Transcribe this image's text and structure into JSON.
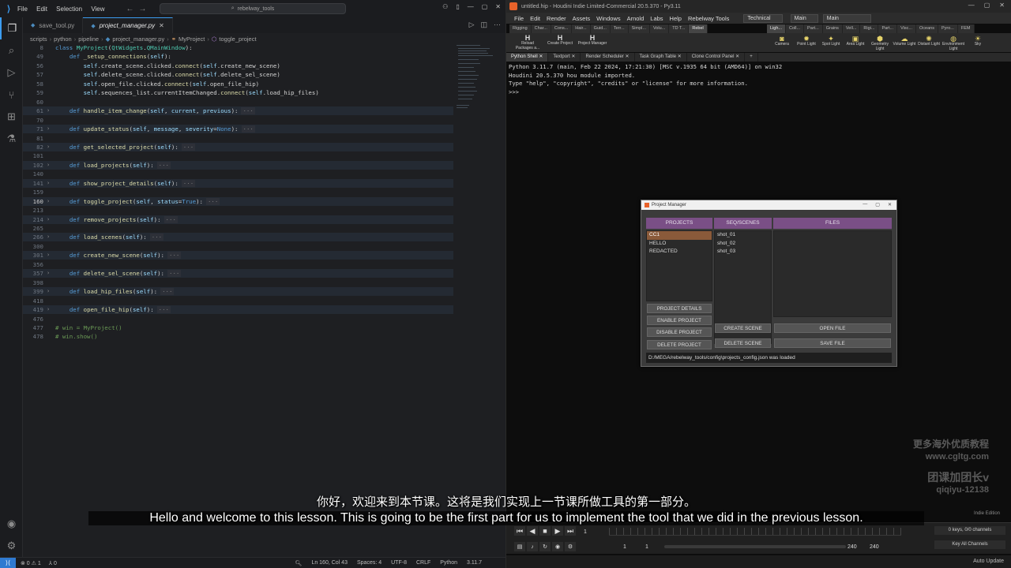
{
  "vscode": {
    "menu": [
      "File",
      "Edit",
      "Selection",
      "View"
    ],
    "search_text": "rebelway_tools",
    "tabs": [
      {
        "label": "save_tool.py",
        "active": false
      },
      {
        "label": "project_manager.py",
        "active": true
      }
    ],
    "breadcrumb": [
      "scripts",
      "python",
      "pipeline",
      "project_manager.py",
      "MyProject",
      "toggle_project"
    ],
    "code_lines": [
      {
        "n": "8",
        "fold": false,
        "chev": false,
        "cur": false,
        "html": "<span class='kw'>class</span> <span class='cls'>MyProject</span>(<span class='cls'>QtWidgets</span>.<span class='cls'>QMainWindow</span>):"
      },
      {
        "n": "49",
        "fold": false,
        "chev": false,
        "cur": false,
        "html": "    <span class='kw'>def</span> <span class='fn'>_setup_connections</span>(<span class='self'>self</span>):"
      },
      {
        "n": "56",
        "fold": false,
        "chev": false,
        "cur": false,
        "html": "        <span class='self'>self</span>.create_scene.clicked.<span class='fn'>connect</span>(<span class='self'>self</span>.create_new_scene)"
      },
      {
        "n": "57",
        "fold": false,
        "chev": false,
        "cur": false,
        "html": "        <span class='self'>self</span>.delete_scene.clicked.<span class='fn'>connect</span>(<span class='self'>self</span>.delete_sel_scene)"
      },
      {
        "n": "58",
        "fold": false,
        "chev": false,
        "cur": false,
        "html": "        <span class='self'>self</span>.open_file.clicked.<span class='fn'>connect</span>(<span class='self'>self</span>.open_file_hip)"
      },
      {
        "n": "59",
        "fold": false,
        "chev": false,
        "cur": false,
        "html": "        <span class='self'>self</span>.sequences_list.currentItemChanged.<span class='fn'>connect</span>(<span class='self'>self</span>.load_hip_files)"
      },
      {
        "n": "60",
        "fold": false,
        "chev": false,
        "cur": false,
        "html": ""
      },
      {
        "n": "61",
        "fold": true,
        "chev": true,
        "cur": false,
        "html": "    <span class='kw'>def</span> <span class='fn'>handle_item_change</span>(<span class='self'>self</span>, <span class='param'>current</span>, <span class='param'>previous</span>):<span class='ellip'>···</span>"
      },
      {
        "n": "70",
        "fold": false,
        "chev": false,
        "cur": false,
        "html": ""
      },
      {
        "n": "71",
        "fold": true,
        "chev": true,
        "cur": false,
        "html": "    <span class='kw'>def</span> <span class='fn'>update_status</span>(<span class='self'>self</span>, <span class='param'>message</span>, <span class='param'>severity</span>=<span class='const'>None</span>):<span class='ellip'>···</span>"
      },
      {
        "n": "81",
        "fold": false,
        "chev": false,
        "cur": false,
        "html": ""
      },
      {
        "n": "82",
        "fold": true,
        "chev": true,
        "cur": false,
        "html": "    <span class='kw'>def</span> <span class='fn'>get_selected_project</span>(<span class='self'>self</span>):<span class='ellip'>···</span>"
      },
      {
        "n": "101",
        "fold": false,
        "chev": false,
        "cur": false,
        "html": ""
      },
      {
        "n": "102",
        "fold": true,
        "chev": true,
        "cur": false,
        "html": "    <span class='kw'>def</span> <span class='fn'>load_projects</span>(<span class='self'>self</span>):<span class='ellip'>···</span>"
      },
      {
        "n": "140",
        "fold": false,
        "chev": false,
        "cur": false,
        "html": ""
      },
      {
        "n": "141",
        "fold": true,
        "chev": true,
        "cur": false,
        "html": "    <span class='kw'>def</span> <span class='fn'>show_project_details</span>(<span class='self'>self</span>):<span class='ellip'>···</span>"
      },
      {
        "n": "159",
        "fold": false,
        "chev": false,
        "cur": false,
        "html": ""
      },
      {
        "n": "160",
        "fold": true,
        "chev": true,
        "cur": true,
        "html": "    <span class='kw'>def</span> <span class='fn'>toggle_project</span>(<span class='self'>self</span>, <span class='param'>status</span>=<span class='const'>True</span>):<span class='ellip'>···</span>"
      },
      {
        "n": "213",
        "fold": false,
        "chev": false,
        "cur": false,
        "html": ""
      },
      {
        "n": "214",
        "fold": true,
        "chev": true,
        "cur": false,
        "html": "    <span class='kw'>def</span> <span class='fn'>remove_projects</span>(<span class='self'>self</span>):<span class='ellip'>···</span>"
      },
      {
        "n": "265",
        "fold": false,
        "chev": false,
        "cur": false,
        "html": ""
      },
      {
        "n": "266",
        "fold": true,
        "chev": true,
        "cur": false,
        "html": "    <span class='kw'>def</span> <span class='fn'>load_scenes</span>(<span class='self'>self</span>):<span class='ellip'>···</span>"
      },
      {
        "n": "300",
        "fold": false,
        "chev": false,
        "cur": false,
        "html": ""
      },
      {
        "n": "301",
        "fold": true,
        "chev": true,
        "cur": false,
        "html": "    <span class='kw'>def</span> <span class='fn'>create_new_scene</span>(<span class='self'>self</span>):<span class='ellip'>···</span>"
      },
      {
        "n": "356",
        "fold": false,
        "chev": false,
        "cur": false,
        "html": ""
      },
      {
        "n": "357",
        "fold": true,
        "chev": true,
        "cur": false,
        "html": "    <span class='kw'>def</span> <span class='fn'>delete_sel_scene</span>(<span class='self'>self</span>):<span class='ellip'>···</span>"
      },
      {
        "n": "398",
        "fold": false,
        "chev": false,
        "cur": false,
        "html": ""
      },
      {
        "n": "399",
        "fold": true,
        "chev": true,
        "cur": false,
        "html": "    <span class='kw'>def</span> <span class='fn'>load_hip_files</span>(<span class='self'>self</span>):<span class='ellip'>···</span>"
      },
      {
        "n": "418",
        "fold": false,
        "chev": false,
        "cur": false,
        "html": ""
      },
      {
        "n": "419",
        "fold": true,
        "chev": true,
        "cur": false,
        "html": "    <span class='kw'>def</span> <span class='fn'>open_file_hip</span>(<span class='self'>self</span>):<span class='ellip'>···</span>"
      },
      {
        "n": "476",
        "fold": false,
        "chev": false,
        "cur": false,
        "html": ""
      },
      {
        "n": "477",
        "fold": false,
        "chev": false,
        "cur": false,
        "html": "<span class='cmt'># win = MyProject()</span>"
      },
      {
        "n": "478",
        "fold": false,
        "chev": false,
        "cur": false,
        "html": "<span class='cmt'># win.show()</span>"
      }
    ],
    "status": {
      "problems": "⊗ 0 ⚠ 1",
      "ports": "⅄ 0",
      "position": "Ln 160, Col 43",
      "spaces": "Spaces: 4",
      "encoding": "UTF-8",
      "eol": "CRLF",
      "language": "Python",
      "version": "3.11.7"
    }
  },
  "houdini": {
    "title": "untitled.hip - Houdini Indie Limited-Commercial 20.5.370 - Py3.11",
    "menu": [
      "File",
      "Edit",
      "Render",
      "Assets",
      "Windows",
      "Arnold",
      "Labs",
      "Help",
      "Rebelway Tools"
    ],
    "desktop": "Technical",
    "desktop2": "Main",
    "desktop3": "Main",
    "shelf_tabs_left": [
      "Rigging",
      "Char...",
      "Cons...",
      "Hair...",
      "Guid...",
      "Terr...",
      "Simpl...",
      "Volu...",
      "TD T...",
      "Rebel"
    ],
    "shelf_tabs_right": [
      "Ligh...",
      "Coll...",
      "Part...",
      "Grains",
      "Vell...",
      "Rigi...",
      "Part...",
      "Visc...",
      "Oceans",
      "Pyro...",
      "FEM"
    ],
    "shelf_tools": [
      {
        "label": "Reload Packages a...",
        "icon": "H"
      },
      {
        "label": "Create Project",
        "icon": "H"
      },
      {
        "label": "Project Manager",
        "icon": "H"
      }
    ],
    "light_tools": [
      "Camera",
      "Point Light",
      "Spot Light",
      "Area Light",
      "Geometry Light",
      "Volume Light",
      "Distant Light",
      "Environment Light",
      "Sky"
    ],
    "pane_tabs": [
      "Python Shell",
      "Textport",
      "Render Scheduler",
      "Task Graph Table",
      "Clone Control Panel"
    ],
    "shell_text": "Python 3.11.7 (main, Feb 22 2024, 17:21:30) [MSC v.1935 64 bit (AMD64)] on win32\nHoudini 20.5.370 hou module imported.\nType \"help\", \"copyright\", \"credits\" or \"license\" for more information.\n>>>",
    "watermark_1": "更多海外优质教程",
    "watermark_2": "www.cgltg.com",
    "watermark_3": "团课加团长v",
    "watermark_4": "qiqiyu-12138",
    "edition": "Indie Edition",
    "timeline": {
      "frame": "1",
      "start": "1",
      "start2": "1",
      "end": "240",
      "end2": "240",
      "keys": "0 keys, 0/0 channels",
      "key_channels": "Key All Channels",
      "auto_update": "Auto Update"
    }
  },
  "project_manager": {
    "title": "Project Manager",
    "headers": {
      "projects": "PROJECTS",
      "scenes": "SEQ/SCENES",
      "files": "FILES"
    },
    "projects": [
      "CC1",
      "HELLO",
      "REDACTED"
    ],
    "selected_project": "CC1",
    "scenes": [
      "shot_01",
      "shot_02",
      "shot_03"
    ],
    "buttons": {
      "details": "PROJECT DETAILS",
      "enable": "ENABLE PROJECT",
      "disable": "DISABLE PROJECT",
      "delete_project": "DELETE PROJECT",
      "create_scene": "CREATE SCENE",
      "delete_scene": "DELETE SCENE",
      "open_file": "OPEN FILE",
      "save_file": "SAVE FILE"
    },
    "status": "D:/MEGA/rebelway_tools/config\\projects_config.json was loaded",
    "colors": {
      "header": "#7a4f86",
      "selected": "#8a5a3a"
    }
  },
  "subtitles": {
    "cn": "你好，欢迎来到本节课。这将是我们实现上一节课所做工具的第一部分。",
    "en": "Hello and welcome to this lesson. This is going to be the first part for us to implement the tool that we did in the previous lesson."
  }
}
